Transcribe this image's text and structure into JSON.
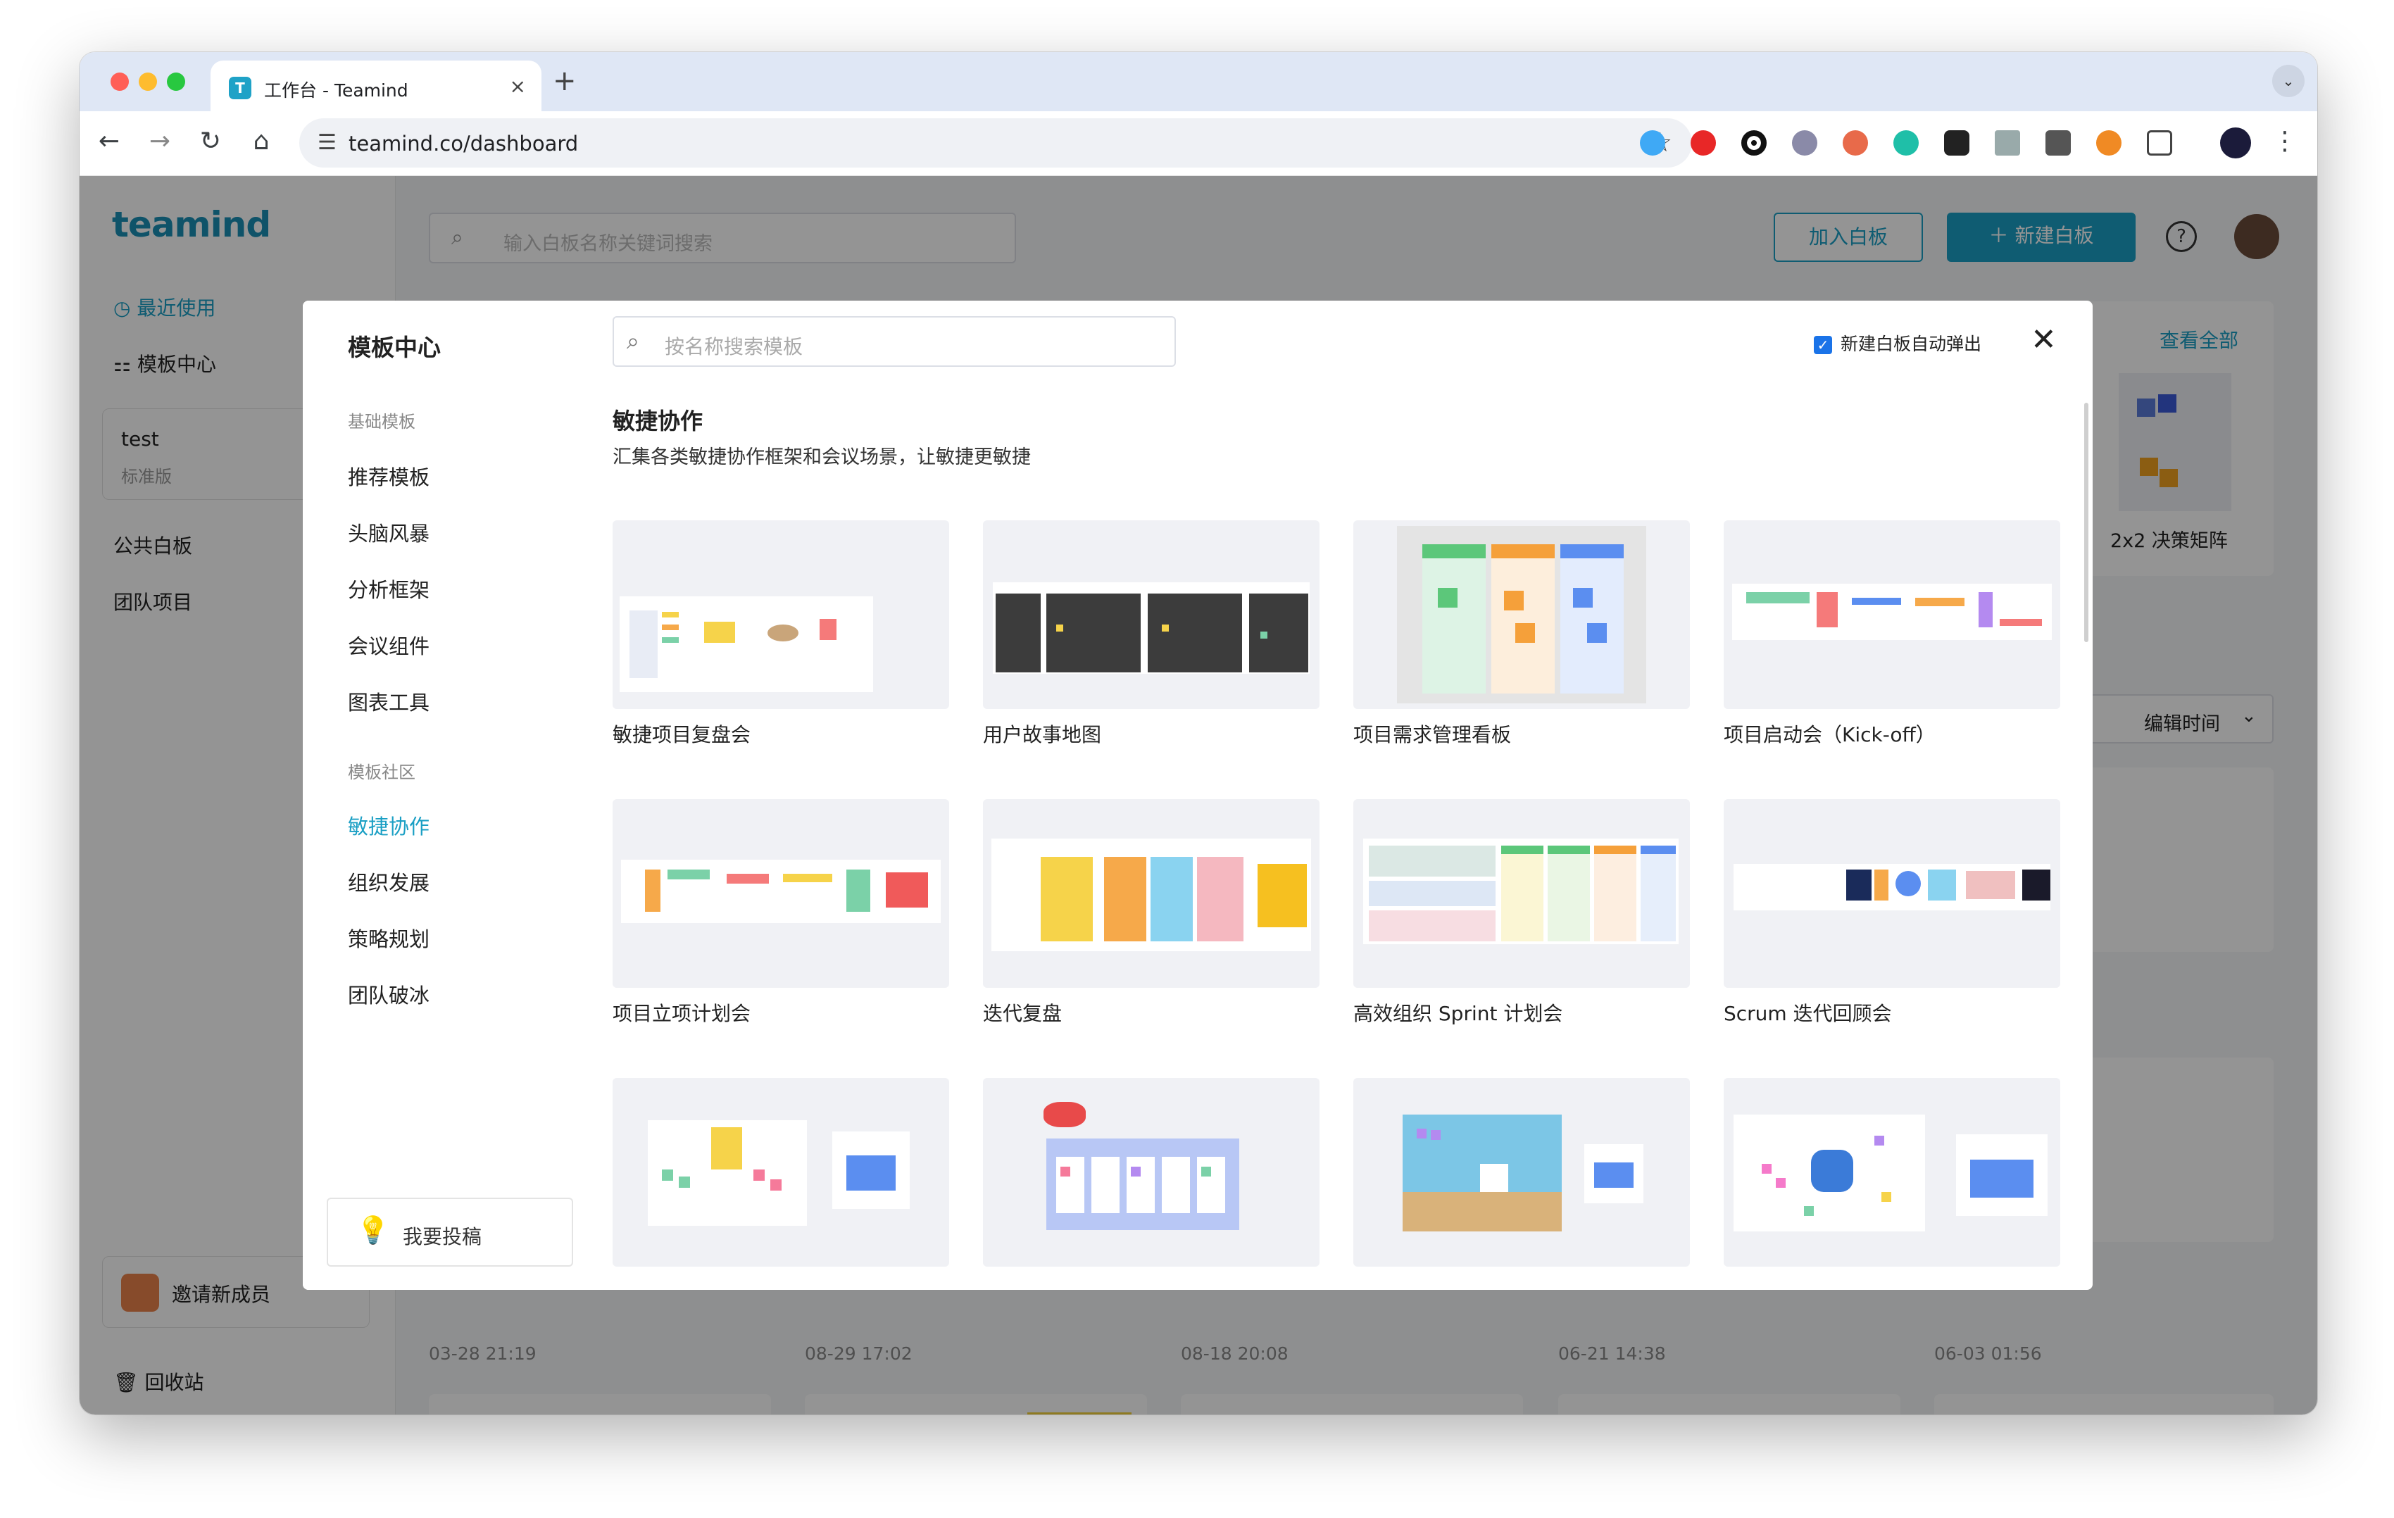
{
  "browser": {
    "tab_title": "工作台 - Teamind",
    "tab_close": "×",
    "new_tab": "+",
    "url": "teamind.co/dashboard"
  },
  "app": {
    "logo": "teamind",
    "search_placeholder": "输入白板名称关键词搜索",
    "join_button": "加入白板",
    "new_button": "新建白板",
    "view_all": "查看全部",
    "bg_template_caption": "2x2 决策矩阵",
    "sort_label": "编辑时间",
    "dates": [
      "03-28 21:19",
      "08-29 17:02",
      "08-18 20:08",
      "06-21 14:38",
      "06-03 01:56"
    ],
    "sidebar": {
      "recent": "最近使用",
      "templates": "模板中心",
      "team_name": "test",
      "team_plan": "标准版",
      "public": "公共白板",
      "team_projects": "团队项目",
      "invite": "邀请新成员",
      "trash": "回收站"
    }
  },
  "modal": {
    "title": "模板中心",
    "basic_section": "基础模板",
    "basic_items": [
      "推荐模板",
      "头脑风暴",
      "分析框架",
      "会议组件",
      "图表工具"
    ],
    "community_section": "模板社区",
    "community_items": [
      "敏捷协作",
      "组织发展",
      "策略规划",
      "团队破冰"
    ],
    "submit_button": "我要投稿",
    "search_placeholder": "按名称搜索模板",
    "auto_popup_label": "新建白板自动弹出",
    "auto_popup_checked": true,
    "category_title": "敏捷协作",
    "category_desc": "汇集各类敏捷协作框架和会议场景，让敏捷更敏捷",
    "templates": [
      "敏捷项目复盘会",
      "用户故事地图",
      "项目需求管理看板",
      "项目启动会（Kick-off）",
      "项目立项计划会",
      "迭代复盘",
      "高效组织 Sprint 计划会",
      "Scrum 迭代回顾会"
    ]
  },
  "colors": {
    "accent": "#1a9fc4",
    "primary_button": "#1a9fc4",
    "overlay": "rgba(0,0,0,0.42)"
  }
}
